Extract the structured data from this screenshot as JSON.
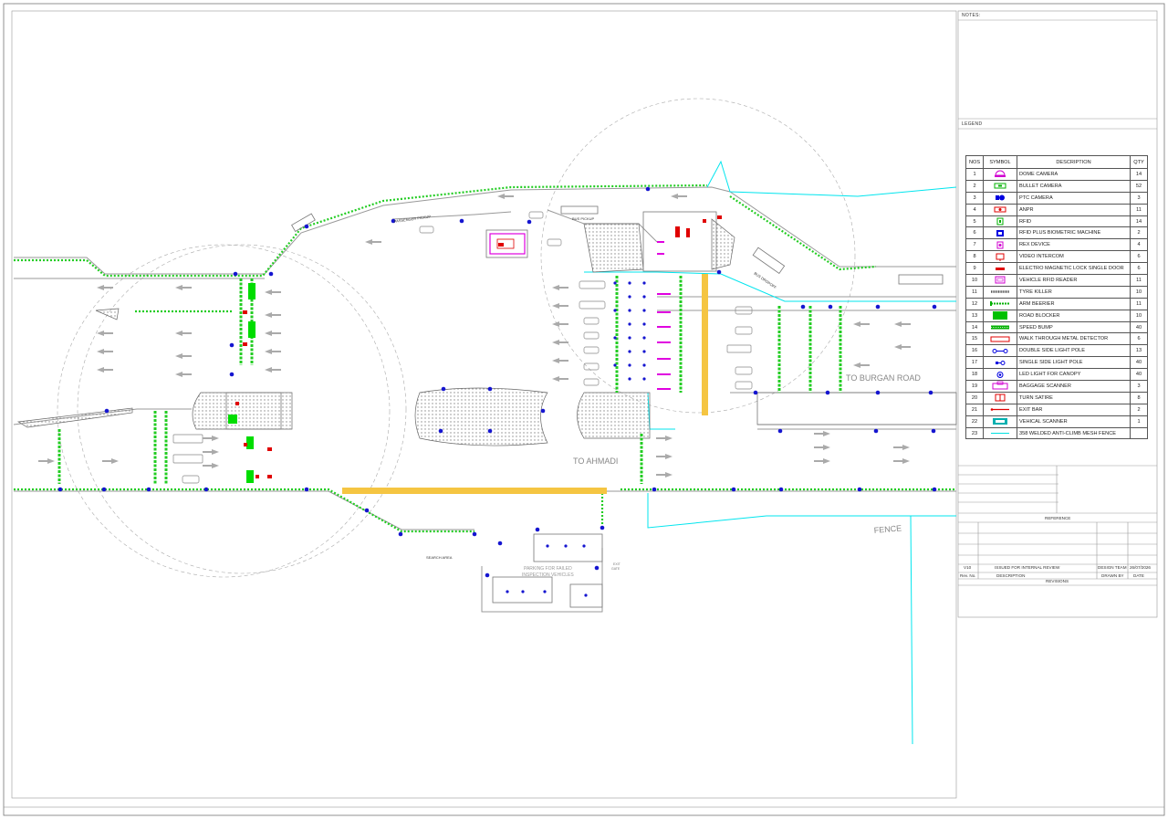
{
  "notes": {
    "label": "NOTES:"
  },
  "legend": {
    "label": "LEGEND",
    "headers": {
      "nos": "NOS",
      "symbol": "SYMBOL",
      "description": "DESCRIPTION",
      "qty": "QTY"
    },
    "items": [
      {
        "no": "1",
        "symbol": "dome-camera-icon",
        "color": "#d000d0",
        "desc": "DOME CAMERA",
        "qty": "14"
      },
      {
        "no": "2",
        "symbol": "bullet-camera-icon",
        "color": "#00b000",
        "desc": "BULLET CAMERA",
        "qty": "52"
      },
      {
        "no": "3",
        "symbol": "ptz-camera-icon",
        "color": "#0000e0",
        "desc": "PTC CAMERA",
        "qty": "3"
      },
      {
        "no": "4",
        "symbol": "anpr-icon",
        "color": "#e00000",
        "desc": "ANPR",
        "qty": "11"
      },
      {
        "no": "5",
        "symbol": "rfid-icon",
        "color": "#00b000",
        "desc": "RFID",
        "qty": "14"
      },
      {
        "no": "6",
        "symbol": "rfid-biometric-icon",
        "color": "#0000e0",
        "desc": "RFID PLUS BIOMETRIC MACHINE",
        "qty": "2"
      },
      {
        "no": "7",
        "symbol": "rex-device-icon",
        "color": "#d000d0",
        "desc": "REX DEVICE",
        "qty": "4"
      },
      {
        "no": "8",
        "symbol": "video-intercom-icon",
        "color": "#e00000",
        "desc": "VIDEO INTERCOM",
        "qty": "6"
      },
      {
        "no": "9",
        "symbol": "electro-magnetic-lock-icon",
        "color": "#e00000",
        "desc": "ELECTRO MAGNETIC LOCK SINGLE DOOR",
        "qty": "6"
      },
      {
        "no": "10",
        "symbol": "vehicle-rfid-reader-icon",
        "color": "#d000d0",
        "desc": "VEHICLE RFID READER",
        "qty": "11"
      },
      {
        "no": "11",
        "symbol": "tyre-killer-icon",
        "color": "#555555",
        "desc": "TYRE KILLER",
        "qty": "10"
      },
      {
        "no": "12",
        "symbol": "arm-barrier-icon",
        "color": "#00b000",
        "desc": "ARM BEERIER",
        "qty": "11"
      },
      {
        "no": "13",
        "symbol": "road-blocker-icon",
        "color": "#00c000",
        "desc": "ROAD BLOCKER",
        "qty": "10"
      },
      {
        "no": "14",
        "symbol": "speed-bump-icon",
        "color": "#00b000",
        "desc": "SPEED BUMP",
        "qty": "40"
      },
      {
        "no": "15",
        "symbol": "metal-detector-icon",
        "color": "#e00000",
        "desc": "WALK THROUGH METAL DETECTOR",
        "qty": "6"
      },
      {
        "no": "16",
        "symbol": "double-light-pole-icon",
        "color": "#0000e0",
        "desc": "DOUBLE SIDE LIGHT POLE",
        "qty": "13"
      },
      {
        "no": "17",
        "symbol": "single-light-pole-icon",
        "color": "#0000e0",
        "desc": "SINGLE SIDE LIGHT POLE",
        "qty": "40"
      },
      {
        "no": "18",
        "symbol": "canopy-light-icon",
        "color": "#0000e0",
        "desc": "LED LIGHT FOR CANOPY",
        "qty": "40"
      },
      {
        "no": "19",
        "symbol": "baggage-scanner-icon",
        "color": "#d000d0",
        "desc": "BAGGAGE SCANNER",
        "qty": "3"
      },
      {
        "no": "20",
        "symbol": "turnstile-icon",
        "color": "#e00000",
        "desc": "TURN SATIRE",
        "qty": "8"
      },
      {
        "no": "21",
        "symbol": "exit-bar-icon",
        "color": "#e00000",
        "desc": "EXIT BAR",
        "qty": "2"
      },
      {
        "no": "22",
        "symbol": "vehicle-scanner-icon",
        "color": "#00b0b0",
        "desc": "VEHICAL SCANNER",
        "qty": "1"
      },
      {
        "no": "23",
        "symbol": "fence-line-icon",
        "color": "#00e0e0",
        "desc": "358 WELDED ANTI-CLIMB MESH FENCE",
        "qty": ""
      }
    ]
  },
  "reference": {
    "label": "REFERENCE"
  },
  "revisions": {
    "row": {
      "rev": "V10",
      "description": "ISSUED FOR INTERNAL REVIEW",
      "drawn_by": "DESIGN TEAM",
      "date": "26/07/2026"
    },
    "headers": {
      "rev": "Rev. No.",
      "description": "DESCRIPTION",
      "drawn_by": "DRAWN BY",
      "date": "DATE"
    },
    "label": "REVISIONS"
  },
  "plan": {
    "to_burgan_road": "TO BURGAN ROAD",
    "to_ahmadi": "TO AHMADI",
    "fence": "FENCE",
    "bus_pickup": "BUS PICKUP",
    "passenger_pickup": "PASSENGER PICKUP",
    "bus_dropoff": "BUS DROPOFF",
    "search_area": "SEARCH AREA",
    "parking_line1": "PARKING FOR FAILED",
    "parking_line2": "INSPECTION VEHICLES",
    "exit_label": "EXIT",
    "gate_label": "GATE"
  },
  "colors": {
    "fence": "#00e5ee",
    "barrier_green": "#22cc22",
    "light_pole_blue": "#1515d0",
    "rfid_magenta": "#e000e0",
    "anpr_red": "#e00000",
    "speed_bump_yellow": "#f5c542",
    "road_grey": "#9a9a9a"
  }
}
